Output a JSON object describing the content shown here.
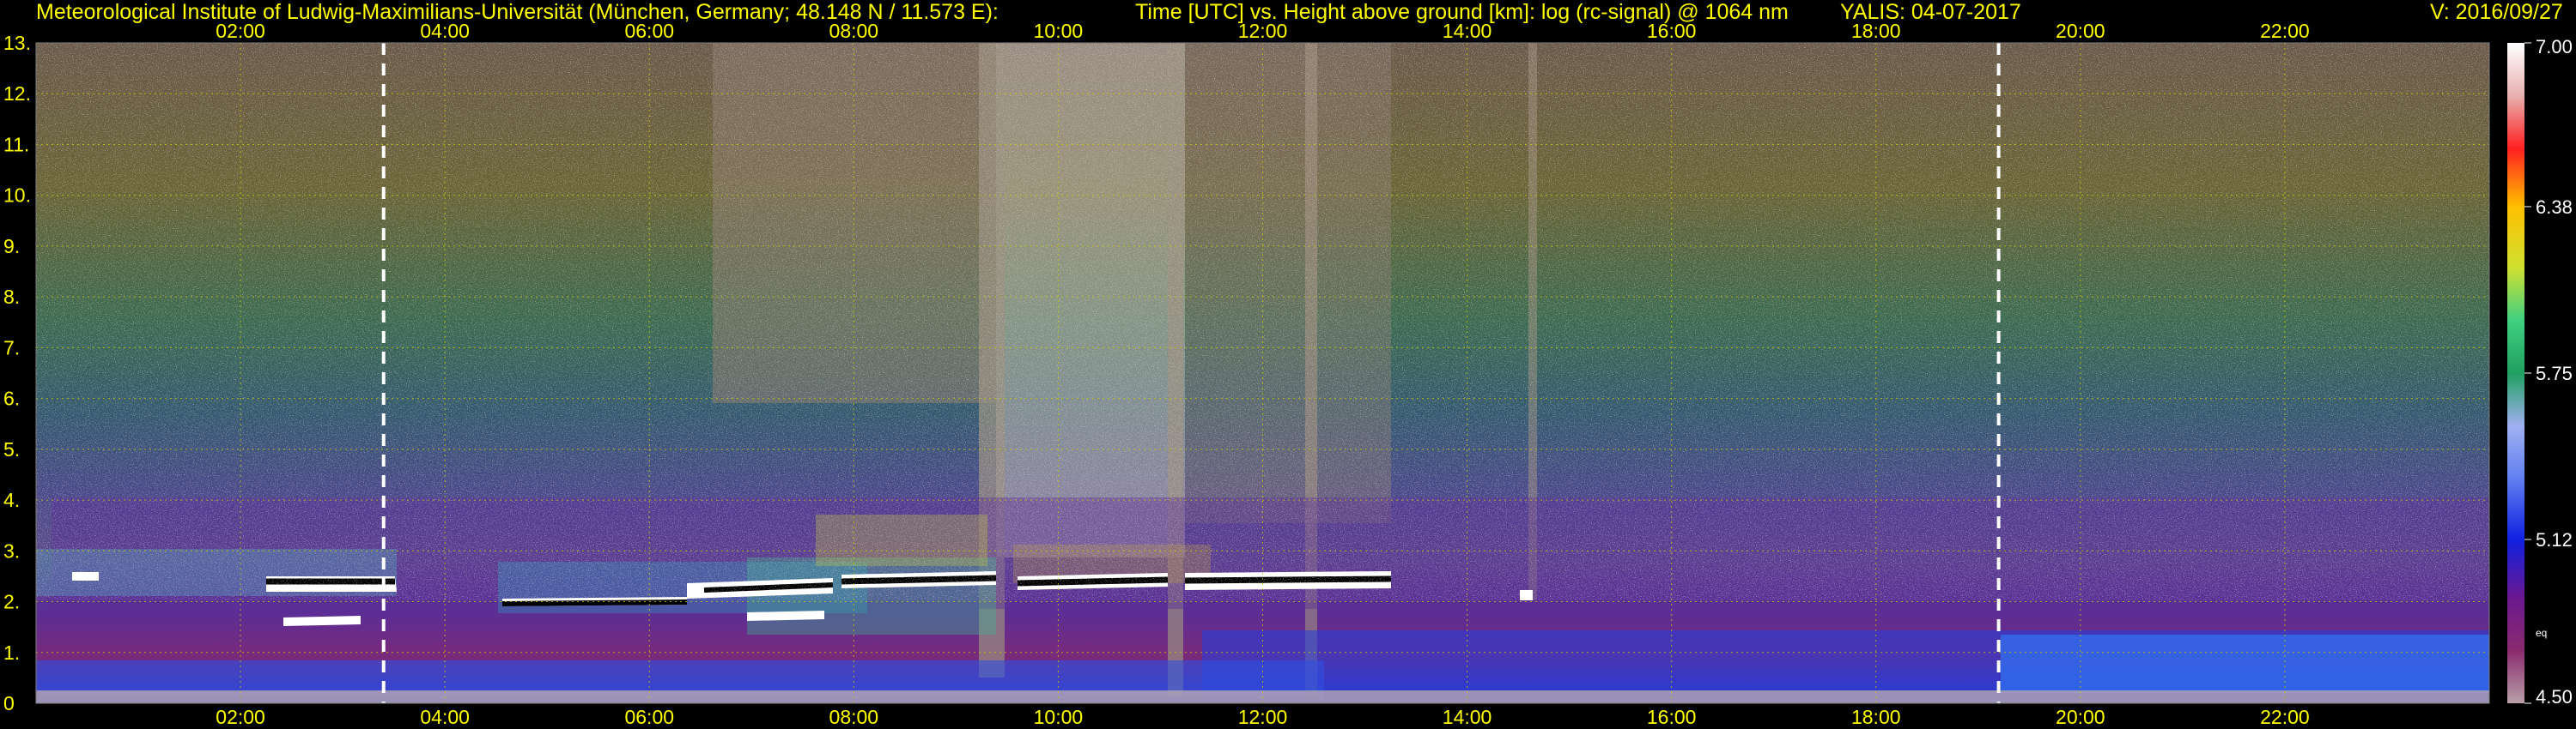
{
  "header": {
    "institute": "Meteorological Institute of Ludwig-Maximilians-Universität (München, Germany; 48.148 N / 11.573 E):",
    "plot_desc": "Time [UTC] vs. Height above ground [km]: log (rc-signal) @ 1064 nm",
    "station_date": "YALIS: 04-07-2017",
    "version": "V: 2016/09/27"
  },
  "chart_data": {
    "type": "heatmap",
    "title": "Time [UTC] vs. Height above ground [km]: log (rc-signal) @ 1064 nm",
    "xlabel": "",
    "ylabel": "",
    "x_ticks": [
      "02:00",
      "04:00",
      "06:00",
      "08:00",
      "10:00",
      "12:00",
      "14:00",
      "16:00",
      "18:00",
      "20:00",
      "22:00"
    ],
    "x_tick_hours": [
      2,
      4,
      6,
      8,
      10,
      12,
      14,
      16,
      18,
      20,
      22
    ],
    "xlim_hours": [
      0,
      24
    ],
    "y_ticks": [
      "0",
      "1.",
      "2.",
      "3.",
      "4.",
      "5.",
      "6.",
      "7.",
      "8.",
      "9.",
      "10.",
      "11.",
      "12.",
      "13."
    ],
    "ylim_km": [
      0,
      13
    ],
    "grid": true,
    "markers_hours": [
      3.4,
      19.2
    ],
    "colorbar": {
      "range": [
        4.5,
        7.0
      ],
      "tick_labels": [
        "7.00",
        "6.38",
        "5.75",
        "5.12",
        "4.50"
      ],
      "tick_values": [
        7.0,
        6.38,
        5.75,
        5.12,
        4.5
      ],
      "extra_label": "eq",
      "stops": [
        {
          "value": 4.5,
          "color": "#b8a0a8"
        },
        {
          "value": 4.7,
          "color": "#8a2a6e"
        },
        {
          "value": 4.9,
          "color": "#6a1890"
        },
        {
          "value": 5.12,
          "color": "#1020e0"
        },
        {
          "value": 5.35,
          "color": "#6080f0"
        },
        {
          "value": 5.55,
          "color": "#a0b0f0"
        },
        {
          "value": 5.75,
          "color": "#20a060"
        },
        {
          "value": 5.95,
          "color": "#40d080"
        },
        {
          "value": 6.15,
          "color": "#d0e030"
        },
        {
          "value": 6.38,
          "color": "#ffc000"
        },
        {
          "value": 6.6,
          "color": "#ff2020"
        },
        {
          "value": 6.8,
          "color": "#e8b0b0"
        },
        {
          "value": 7.0,
          "color": "#ffffff"
        }
      ]
    }
  }
}
